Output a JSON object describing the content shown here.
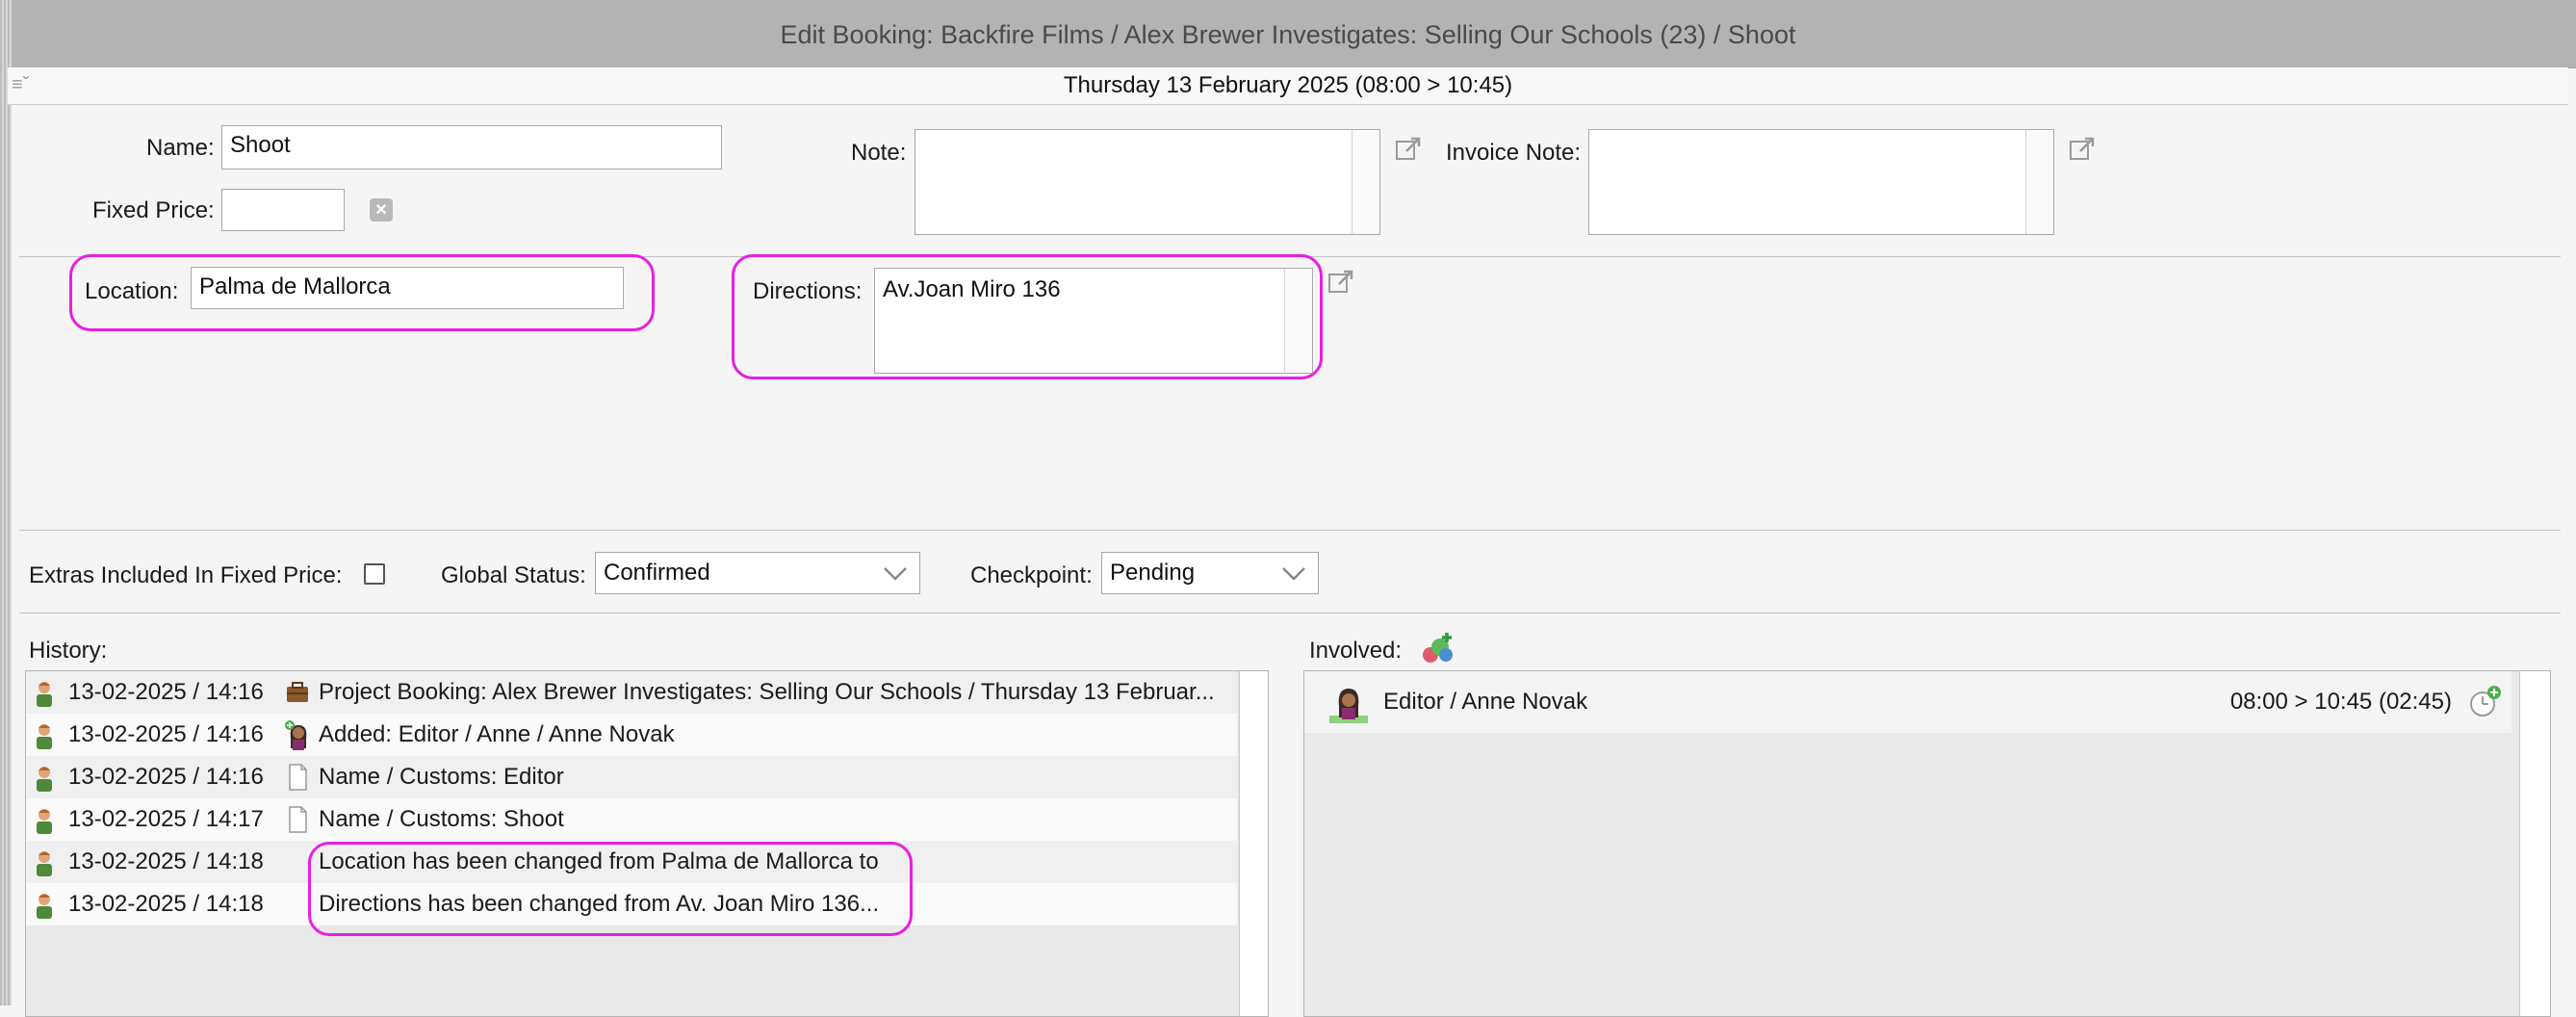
{
  "window": {
    "title": "Edit Booking: Backfire Films / Alex Brewer Investigates: Selling Our Schools (23) / Shoot"
  },
  "datebar": {
    "date": "Thursday 13 February 2025 (08:00 > 10:45)"
  },
  "form": {
    "name_label": "Name:",
    "name_value": "Shoot",
    "fixed_price_label": "Fixed Price:",
    "fixed_price_value": "",
    "note_label": "Note:",
    "note_value": "",
    "invoice_note_label": "Invoice Note:",
    "invoice_note_value": "",
    "location_label": "Location:",
    "location_value": "Palma de Mallorca",
    "directions_label": "Directions:",
    "directions_value": "Av.Joan Miro 136",
    "extras_label": "Extras Included In Fixed Price:",
    "extras_checked": false,
    "global_status_label": "Global Status:",
    "global_status_value": "Confirmed",
    "checkpoint_label": "Checkpoint:",
    "checkpoint_value": "Pending"
  },
  "history": {
    "label": "History:",
    "rows": [
      {
        "timestamp": "13-02-2025 / 14:16",
        "icon": "briefcase-icon",
        "text": "Project Booking: Alex Brewer Investigates: Selling Our Schools / Thursday 13 Februar..."
      },
      {
        "timestamp": "13-02-2025 / 14:16",
        "icon": "person-added-icon",
        "text": "Added: Editor / Anne / Anne Novak"
      },
      {
        "timestamp": "13-02-2025 / 14:16",
        "icon": "document-icon",
        "text": "Name / Customs: Editor"
      },
      {
        "timestamp": "13-02-2025 / 14:17",
        "icon": "document-icon",
        "text": "Name / Customs: Shoot"
      },
      {
        "timestamp": "13-02-2025 / 14:18",
        "icon": "",
        "text": "Location has been changed from Palma de Mallorca to"
      },
      {
        "timestamp": "13-02-2025 / 14:18",
        "icon": "",
        "text": "Directions has been changed from Av. Joan Miro 136..."
      }
    ]
  },
  "involved": {
    "label": "Involved:",
    "rows": [
      {
        "name": "Editor / Anne Novak",
        "time": "08:00 > 10:45 (02:45)"
      }
    ]
  },
  "colors": {
    "highlight": "#e81fe0",
    "titlebar": "#b3b3b3"
  }
}
